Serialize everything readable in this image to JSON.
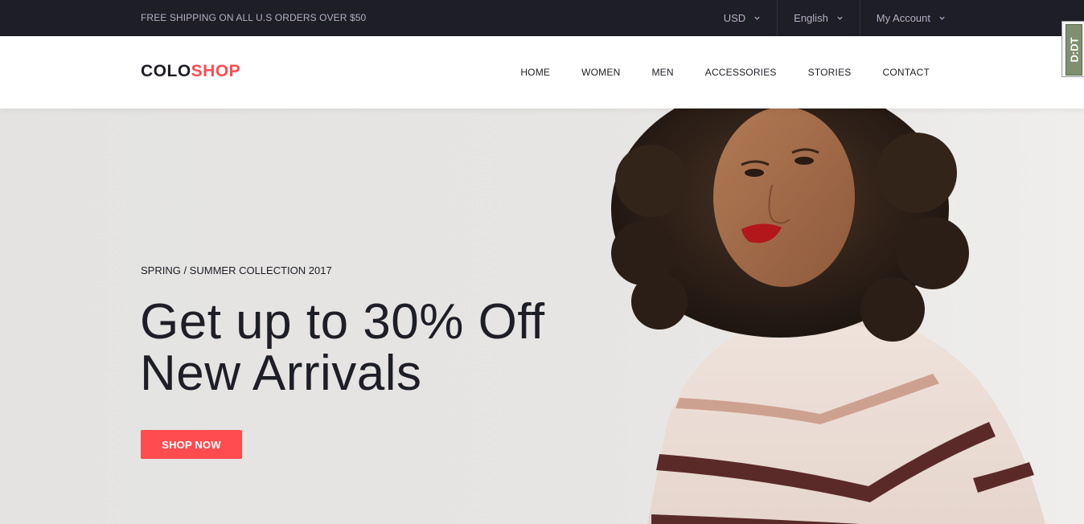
{
  "top_bar": {
    "shipping": "FREE SHIPPING ON ALL U.S ORDERS OVER $50",
    "currency": "USD",
    "language": "English",
    "account": "My Account"
  },
  "header": {
    "logo_part1": "COLO",
    "logo_part2": "SHOP",
    "nav": [
      "HOME",
      "WOMEN",
      "MEN",
      "ACCESSORIES",
      "STORIES",
      "CONTACT"
    ]
  },
  "hero": {
    "subtitle": "SPRING / SUMMER COLLECTION 2017",
    "title_line1": "Get up to 30% Off",
    "title_line2": "New Arrivals",
    "cta": "SHOP NOW"
  },
  "side_widget": {
    "label": "D:DT"
  },
  "colors": {
    "accent": "#fe4c50",
    "dark": "#1e1e27",
    "top_bar_text": "#b5aec4",
    "hero_bg": "#e6e5e3"
  },
  "icons": {
    "dropdown": "chevron-down-icon"
  }
}
